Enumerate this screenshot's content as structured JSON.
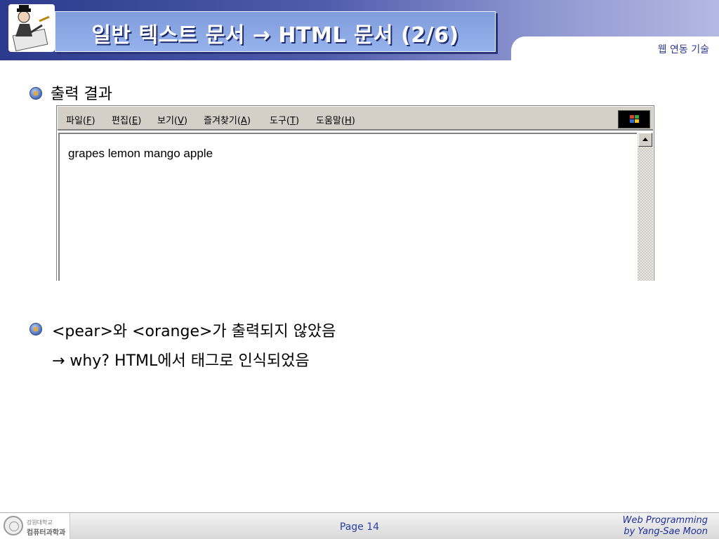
{
  "header": {
    "title": "일반 텍스트 문서 → HTML 문서 (2/6)",
    "subtitle": "웹 연동 기술"
  },
  "bullets": [
    {
      "text": "출력 결과"
    },
    {
      "text": "<pear>와 <orange>가 출력되지 않았음"
    },
    {
      "text": "→ why? HTML에서 태그로 인식되었음"
    }
  ],
  "browser": {
    "menu": [
      {
        "label": "파일",
        "key": "F"
      },
      {
        "label": "편집",
        "key": "E"
      },
      {
        "label": "보기",
        "key": "V"
      },
      {
        "label": "즐겨찾기",
        "key": "A"
      },
      {
        "label": "도구",
        "key": "T"
      },
      {
        "label": "도움말",
        "key": "H"
      }
    ],
    "content": "grapes lemon mango apple"
  },
  "footer": {
    "logo_line1": "강원대학교",
    "logo_line2": "컴퓨터과학과",
    "page": "Page 14",
    "credit_line1": "Web Programming",
    "credit_line2": "by Yang-Sae Moon"
  },
  "icons": [
    "presenter-logo-icon",
    "bullet-icon",
    "windows-flag-icon",
    "scroll-up-arrow-icon",
    "university-seal-icon"
  ],
  "colors": {
    "header_blue": "#2b3a8c",
    "title_box": "#8aa6e4",
    "accent_text": "#2a3ea8",
    "window_gray": "#d4d0c8"
  }
}
